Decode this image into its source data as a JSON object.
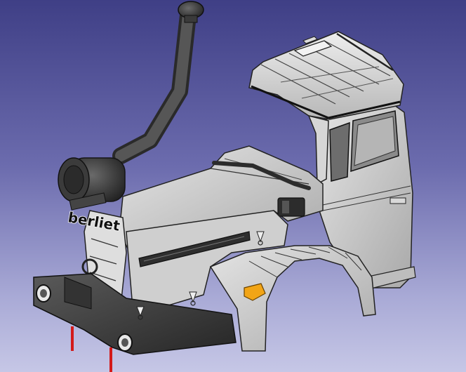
{
  "viewport": {
    "background_top": "#3f3f86",
    "background_bottom": "#c6c7e6"
  },
  "model": {
    "brand_lettering": "berliet",
    "body_color": "#cfcfcf",
    "dark_part_color": "#3d3d3d",
    "selection_edge_color": "#111111",
    "marker_color": "#d31a1a",
    "indicator_lamp_color": "#f2a516"
  },
  "icons": [
    "truck-cab-model",
    "snorkel-intake",
    "air-filter",
    "front-bumper",
    "tow-hook",
    "fender",
    "axis-marker"
  ]
}
